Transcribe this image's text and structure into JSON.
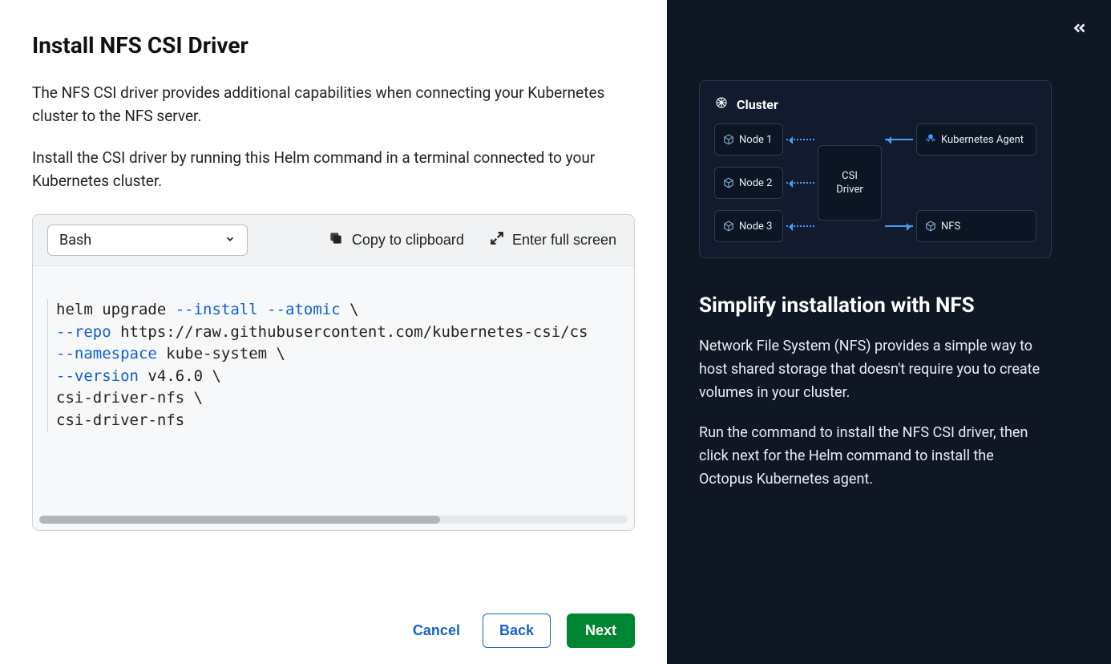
{
  "main": {
    "title": "Install NFS CSI Driver",
    "intro": "The NFS CSI driver provides additional capabilities when connecting your Kubernetes cluster to the NFS server.",
    "instruction": "Install the CSI driver by running this Helm command in a terminal connected to your Kubernetes cluster.",
    "language_selected": "Bash",
    "copy_label": "Copy to clipboard",
    "fullscreen_label": "Enter full screen",
    "code": {
      "line1_a": "helm upgrade ",
      "line1_flag1": "--install",
      "line1_mid": " ",
      "line1_flag2": "--atomic",
      "line1_b": " \\",
      "line2_flag": "--repo",
      "line2_rest": " https://raw.githubusercontent.com/kubernetes-csi/cs",
      "line3_flag": "--namespace",
      "line3_rest": " kube-system \\",
      "line4_flag": "--version",
      "line4_rest": " v4.6.0 \\",
      "line5": "csi-driver-nfs \\",
      "line6": "csi-driver-nfs"
    },
    "cancel_label": "Cancel",
    "back_label": "Back",
    "next_label": "Next"
  },
  "sidebar": {
    "diagram": {
      "cluster_label": "Cluster",
      "nodes": [
        "Node 1",
        "Node 2",
        "Node 3"
      ],
      "csi_line1": "CSI",
      "csi_line2": "Driver",
      "agent_label": "Kubernetes Agent",
      "nfs_label": "NFS"
    },
    "title": "Simplify installation with NFS",
    "p1": "Network File System (NFS) provides a simple way to host shared storage that doesn't require you to create volumes in your cluster.",
    "p2": "Run the command to install the NFS CSI driver, then click next for the Helm command to install the Octopus Kubernetes agent."
  }
}
